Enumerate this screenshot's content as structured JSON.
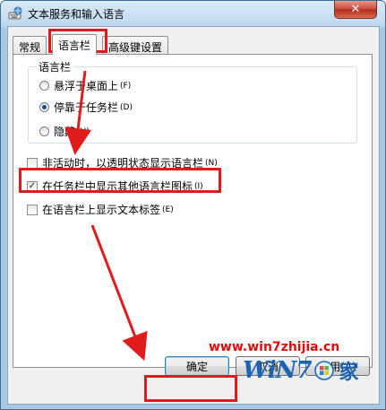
{
  "window": {
    "title": "文本服务和输入语言",
    "close_label": "✕"
  },
  "tabs": [
    {
      "label": "常规"
    },
    {
      "label": "语言栏"
    },
    {
      "label": "高级键设置"
    }
  ],
  "language_bar": {
    "group_label": "语言栏",
    "options": [
      {
        "label": "悬浮于桌面上",
        "hotkey": "(F)",
        "selected": false
      },
      {
        "label": "停靠于任务栏",
        "hotkey": "(D)",
        "selected": true
      },
      {
        "label": "隐藏",
        "hotkey": "(H)",
        "selected": false
      }
    ]
  },
  "checkboxes": [
    {
      "label": "非活动时，以透明状态显示语言栏",
      "hotkey": "(N)",
      "checked": false
    },
    {
      "label": "在任务栏中显示其他语言栏图标",
      "hotkey": "(I)",
      "checked": true
    },
    {
      "label": "在语言栏上显示文本标签",
      "hotkey": "(E)",
      "checked": false
    }
  ],
  "buttons": {
    "ok": "确定",
    "cancel": "取消",
    "apply": "应用(A)"
  },
  "watermark": {
    "url": "www.win7zhijia.cn",
    "logo_w": "WiN",
    "logo_7": "7",
    "logo_jia": "家"
  },
  "colors": {
    "annotation": "#e01b1b",
    "logo": "#1b64b5"
  }
}
